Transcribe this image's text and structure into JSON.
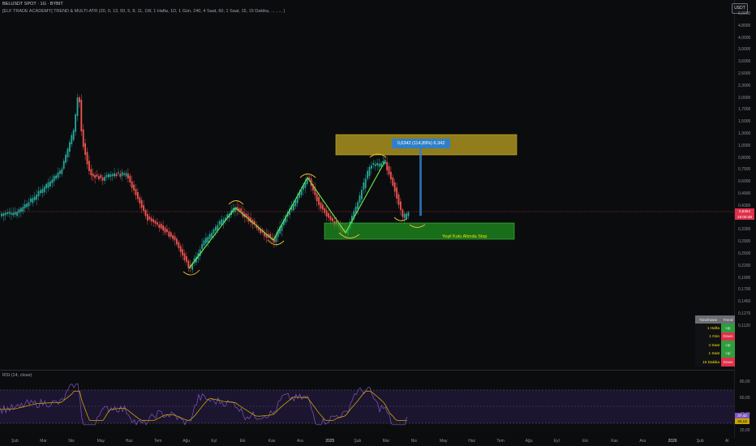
{
  "legend": {
    "title": "BELUSDT SPOT · 1G · BYBIT",
    "indicator": "[ELF TRADE ACADEMY] TREND & MULTI-ATR (20, 0, 13, 50, 5, 8, 11, 1W, 1 Hafta, 1D, 1 Gün, 240, 4 Saat, 60, 1 Saat, 15, 15 Dakika, ... , ... )",
    "rsi": "RSI (14, close)"
  },
  "currency_button": "USDT",
  "price_axis": [
    "6,0000",
    "4,8000",
    "4,0000",
    "3,0000",
    "3,6000",
    "2,6000",
    "2,3000",
    "2,0000",
    "1,7000",
    "1,5000",
    "1,3000",
    "1,0000",
    "0,8000",
    "0,7500",
    "0,6000",
    "0,4900",
    "0,4300",
    "0,3800",
    "0,3300",
    "0,2900",
    "0,2500",
    "0,2200",
    "0,1900",
    "0,1700",
    "0,1450",
    "0,1270",
    "0,1120"
  ],
  "rsi_axis": [
    "80,00",
    "60,00",
    "40,00",
    "20,00"
  ],
  "time_axis": [
    "Şub",
    "Mar",
    "Nis",
    "May",
    "Haz",
    "Tem",
    "Ağu",
    "Eyl",
    "Eki",
    "Kas",
    "Ara",
    "2025",
    "Şub",
    "Mar",
    "Nis",
    "May",
    "Haz",
    "Tem",
    "Ağu",
    "Eyl",
    "Eki",
    "Kas",
    "Ara",
    "2026",
    "Şub",
    "Al"
  ],
  "price_badge": {
    "price": "0,6254",
    "countdown": "15:00:48"
  },
  "rsi_badges": [
    "37,42",
    "34,13"
  ],
  "measure_label": "0,6342 (114,89%) 6.342",
  "stop_label": "Yeşil Kutu Altında Stop",
  "trend_table": {
    "headers": [
      "Timeframe",
      "Trend"
    ],
    "rows": [
      {
        "tf": "1 Hafta",
        "trend": "Up"
      },
      {
        "tf": "1 Gün",
        "trend": "Down"
      },
      {
        "tf": "4 Saat",
        "trend": "Up"
      },
      {
        "tf": "1 Saat",
        "trend": "Up"
      },
      {
        "tf": "15 Dakika",
        "trend": "Down"
      }
    ]
  },
  "colors": {
    "up": "#26a69a",
    "down": "#ef5350",
    "zigzag": "#6cf24a",
    "target_box": "#b39a1f",
    "stop_box": "#1f8f1f",
    "rsi": "#7e57c2",
    "rsi_ma": "#c9a500"
  }
}
